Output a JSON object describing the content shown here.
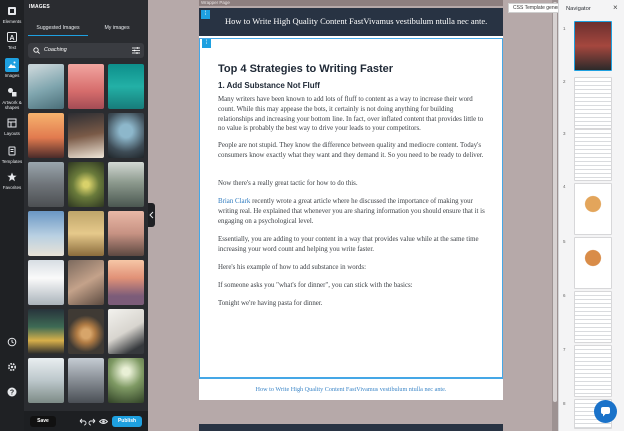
{
  "rail": {
    "items": [
      {
        "label": "Elements",
        "icon": "elements-icon"
      },
      {
        "label": "Text",
        "icon": "text-icon"
      },
      {
        "label": "Images",
        "icon": "image-icon"
      },
      {
        "label": "Artwork & shapes",
        "icon": "shapes-icon"
      },
      {
        "label": "Layouts",
        "icon": "layouts-icon"
      },
      {
        "label": "Templates",
        "icon": "templates-icon"
      },
      {
        "label": "Favorites",
        "icon": "star-icon"
      }
    ],
    "bottom_icons": [
      "history-icon",
      "settings-icon",
      "help-icon"
    ]
  },
  "panel": {
    "title": "IMAGES",
    "tabs": [
      "Suggested Images",
      "My images"
    ],
    "search": {
      "value": "Coaching",
      "placeholder": "Search"
    }
  },
  "footer": {
    "save_label": "Save",
    "publish_label": "Publish"
  },
  "canvas": {
    "page_tag": "Wrapper Page",
    "header_title": "How to Write High Quality Content FastVivamus vestibulum ntulla nec ante.",
    "h1": "Top 4 Strategies to Writing Faster",
    "h2": "1. Add Substance Not Fluff",
    "paragraphs": [
      "Many writers have been known to add lots of fluff to content as a way to increase their word count. While this may appease the bots, it certainly is not doing anything for building relationships and increasing your bottom line. In fact, over inflated content that provides little to no value is probably the best way to drive your leads to your competitors.",
      "People are not stupid. They know the difference between quality and mediocre content. Today's consumers know exactly what they want and they demand it. So you need to be ready to deliver.",
      "Now there's a really great tactic for how to do this.",
      "recently wrote a great article where he discussed the importance of making your writing real. He explained that whenever you are sharing information you should ensure that it is engaging on a psychological level.",
      "Essentially, you are adding to your content in a way that provides value while at the same time increasing your word count and helping you write faster.",
      "Here's his example of how to add substance in words:",
      "If someone asks you \"what's for dinner\", you can stick with the basics:",
      "Tonight we're having pasta for dinner."
    ],
    "link_text": "Brian Clark",
    "footer_text": "How to Write High Quality Content FastVivamus vestibulum ntulla nec ante."
  },
  "tooltip": "CSS Template generator",
  "navigator": {
    "title": "Navigator",
    "pages": [
      "1",
      "2",
      "3",
      "4",
      "5",
      "6",
      "7",
      "8"
    ]
  },
  "colors": {
    "accent": "#1ea0e0",
    "header": "#283343",
    "panel": "#2a2c30",
    "canvas_bg": "#b6a9a9"
  }
}
